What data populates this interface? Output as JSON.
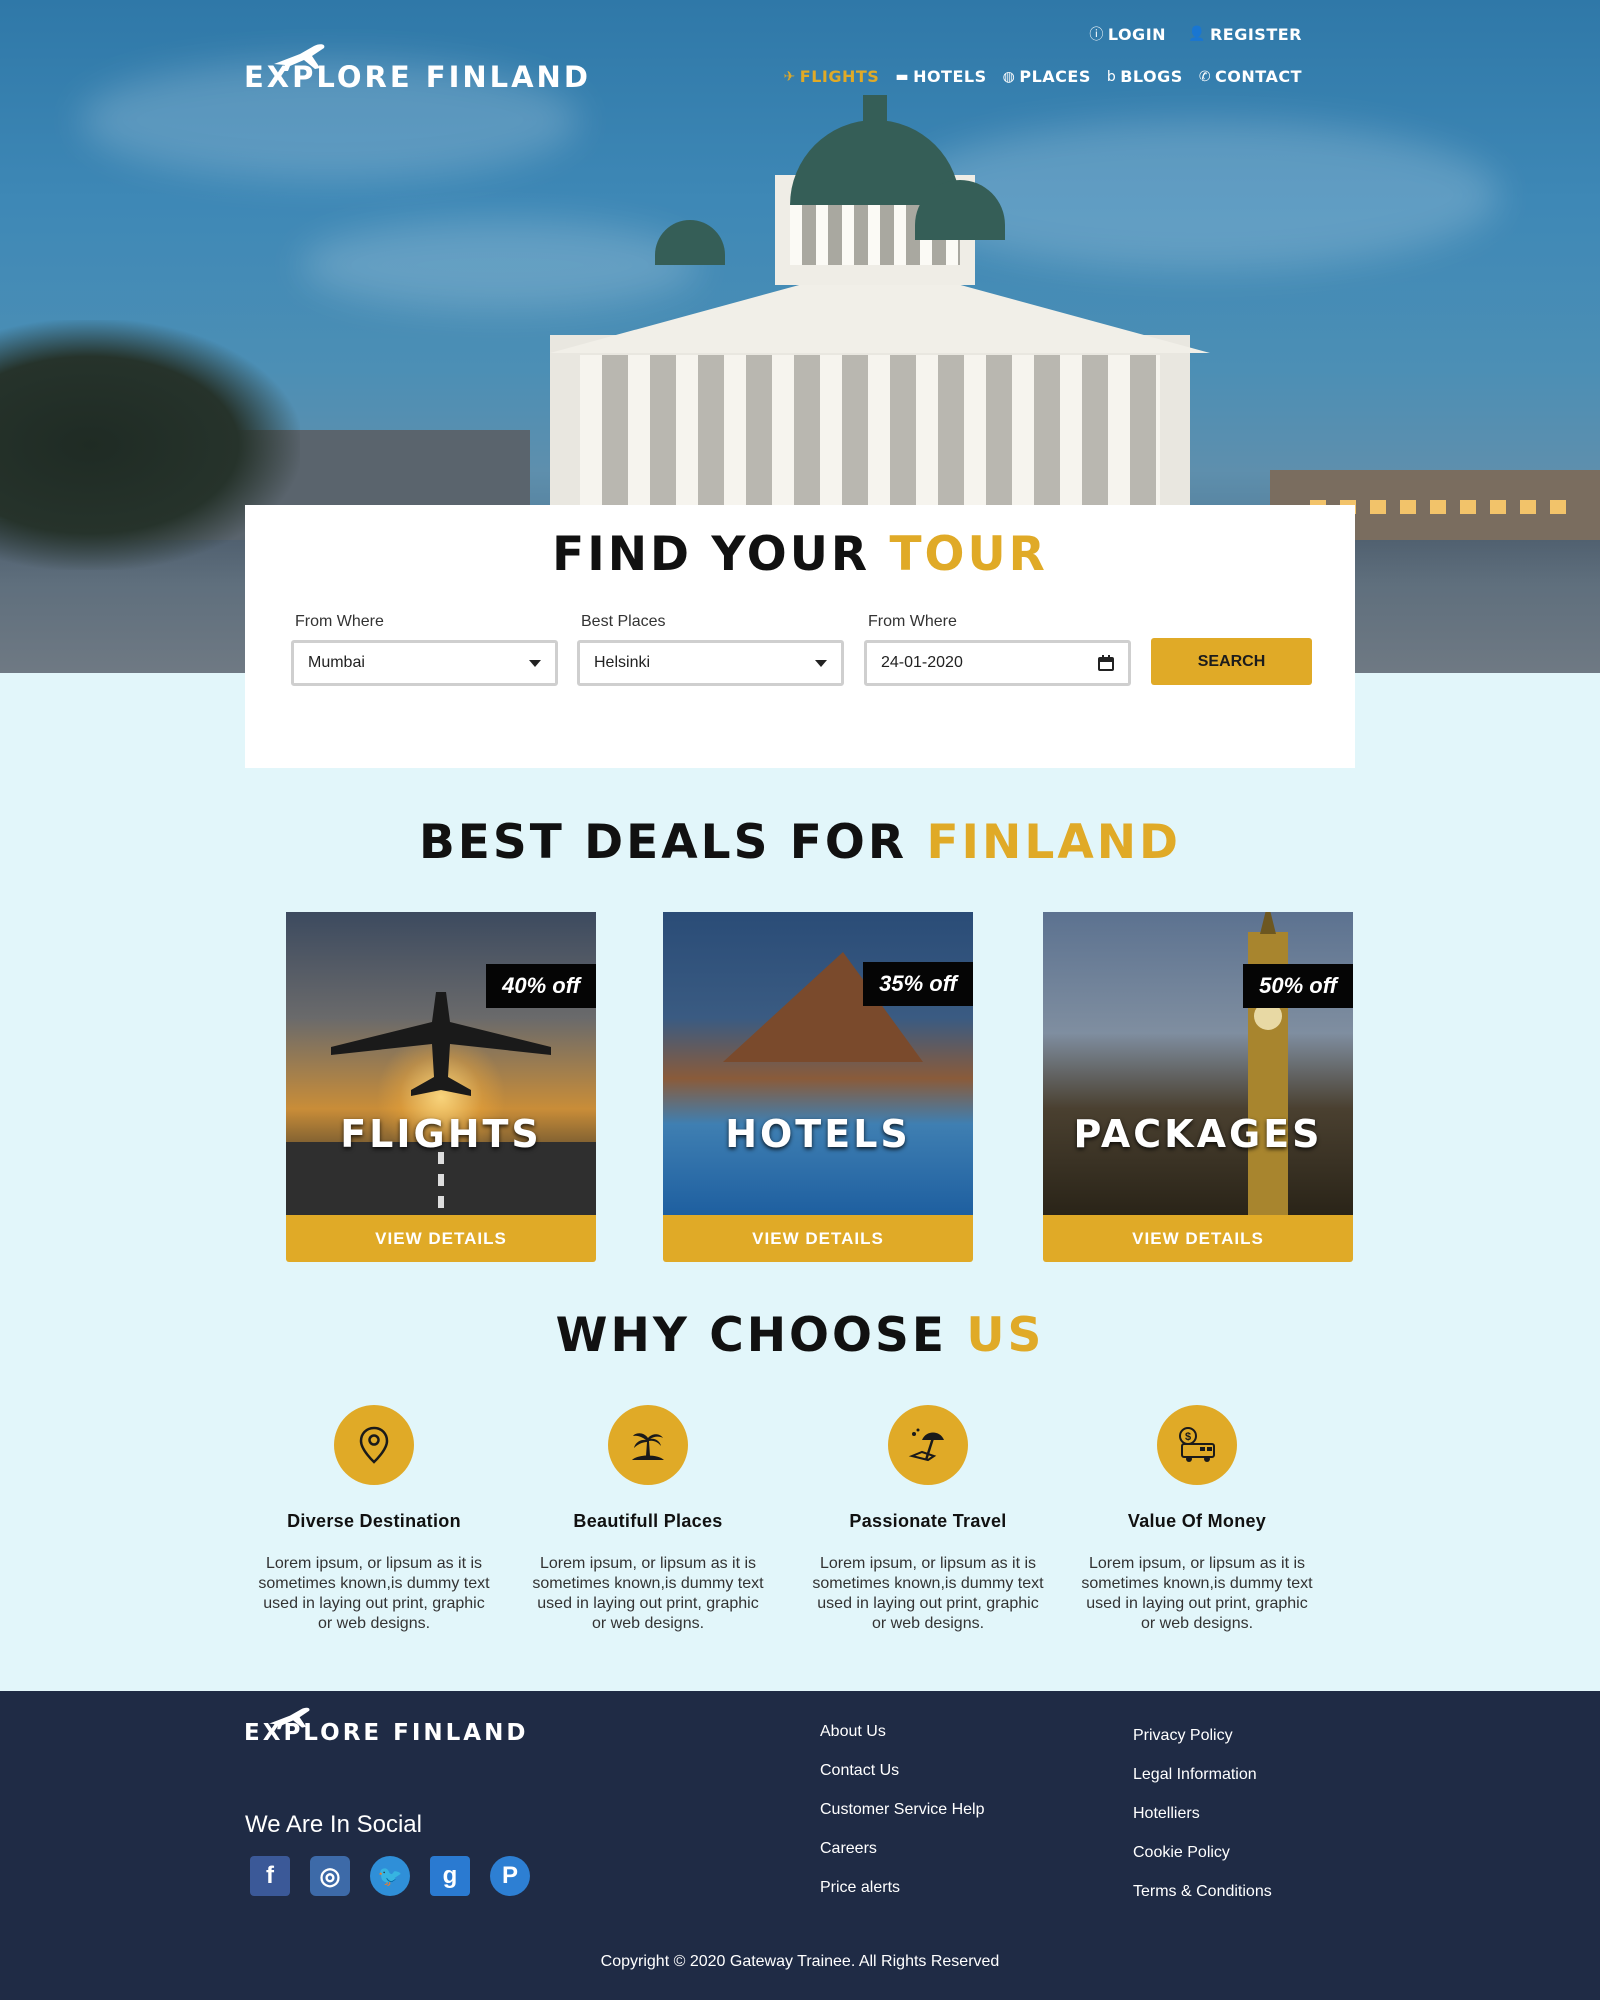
{
  "brand": {
    "name": "EXPLORE FINLAND"
  },
  "header": {
    "top_links": [
      {
        "label": "LOGIN",
        "icon": "user-circle-icon"
      },
      {
        "label": "REGISTER",
        "icon": "user-add-icon"
      }
    ],
    "nav": [
      {
        "label": "FLIGHTS",
        "icon": "plane-icon",
        "active": true
      },
      {
        "label": "HOTELS",
        "icon": "bed-icon"
      },
      {
        "label": "PLACES",
        "icon": "globe-icon"
      },
      {
        "label": "BLOGS",
        "icon": "blog-icon"
      },
      {
        "label": "CONTACT",
        "icon": "phone-icon"
      }
    ]
  },
  "search": {
    "title_main": "FIND YOUR",
    "title_accent": "TOUR",
    "fields": [
      {
        "label": "From Where",
        "value": "Mumbai",
        "type": "select"
      },
      {
        "label": "Best Places",
        "value": "Helsinki",
        "type": "select"
      },
      {
        "label": "From Where",
        "value": "24-01-2020",
        "type": "date"
      }
    ],
    "button": "SEARCH"
  },
  "deals": {
    "title_main": "BEST DEALS FOR",
    "title_accent": "FINLAND",
    "cards": [
      {
        "name": "FLIGHTS",
        "discount": "40% off",
        "button": "VIEW DETAILS"
      },
      {
        "name": "HOTELS",
        "discount": "35% off",
        "button": "VIEW DETAILS"
      },
      {
        "name": "PACKAGES",
        "discount": "50% off",
        "button": "VIEW DETAILS"
      }
    ]
  },
  "why": {
    "title_main": "WHY CHOOSE",
    "title_accent": "US",
    "features": [
      {
        "title": "Diverse Destination",
        "icon": "map-pin-icon",
        "text": "Lorem ipsum, or lipsum as it is sometimes known,is dummy text used in laying out print, graphic or web designs."
      },
      {
        "title": "Beautifull Places",
        "icon": "palm-island-icon",
        "text": "Lorem ipsum, or lipsum as it is sometimes known,is dummy text used in laying out print, graphic or web designs."
      },
      {
        "title": "Passionate Travel",
        "icon": "beach-umbrella-icon",
        "text": "Lorem ipsum, or lipsum as it is sometimes known,is dummy text used in laying out print, graphic or web designs."
      },
      {
        "title": "Value Of Money",
        "icon": "money-van-icon",
        "text": "Lorem ipsum, or lipsum as it is sometimes known,is dummy text used in laying out print, graphic or web designs."
      }
    ]
  },
  "footer": {
    "social_title": "We Are In Social",
    "socials": [
      {
        "name": "facebook-icon",
        "glyph": "f"
      },
      {
        "name": "instagram-icon",
        "glyph": "◎"
      },
      {
        "name": "twitter-icon",
        "glyph": "🐦"
      },
      {
        "name": "google-icon",
        "glyph": "g"
      },
      {
        "name": "pinterest-icon",
        "glyph": "P"
      }
    ],
    "links_col1": [
      "About Us",
      "Contact Us",
      "Customer Service Help",
      "Careers",
      "Price alerts"
    ],
    "links_col2": [
      "Privacy Policy",
      "Legal Information",
      "Hotelliers",
      "Cookie Policy",
      "Terms & Conditions"
    ],
    "copyright": "Copyright © 2020 Gateway Trainee. All Rights Reserved"
  },
  "colors": {
    "accent": "#e0aa27",
    "footer_bg": "#1f2b45",
    "page_bg": "#e2f6fa"
  }
}
